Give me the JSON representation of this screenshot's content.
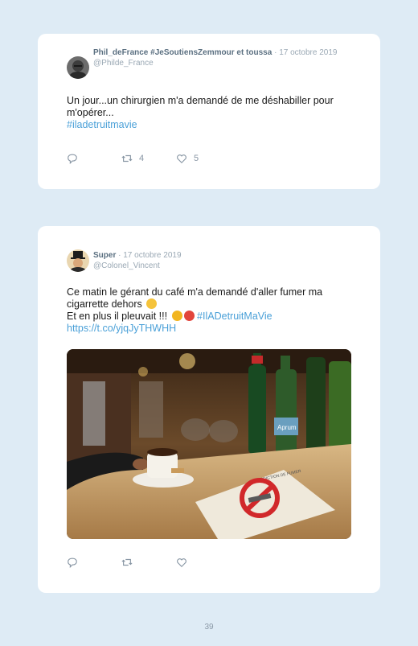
{
  "tweets": [
    {
      "display_name": "Phil_deFrance #JeSoutiensZemmour et toussa",
      "separator": " · ",
      "date": "17 octobre 2019",
      "handle": "@Philde_France",
      "text": "Un jour...un chirurgien m'a demandé de me déshabiller pour m'opérer...",
      "hashtag": "#iladetruitmavie",
      "retweets": "4",
      "likes": "5"
    },
    {
      "display_name": "Super",
      "separator": " · ",
      "date": "17 octobre 2019",
      "handle": "@Colonel_Vincent",
      "text_line1": "Ce matin le gérant du café m'a demandé d'aller fumer ma cigarrette dehors",
      "text_line2": "Et en plus il pleuvait !!!",
      "hashtag": "#IlADetruitMaVie",
      "link": "https://t.co/yjqJyTHWHH",
      "photo_sign_title": "INTERDICTION DE FUMER",
      "photo_bottle_label": "Aprum"
    }
  ],
  "page_number": "39"
}
